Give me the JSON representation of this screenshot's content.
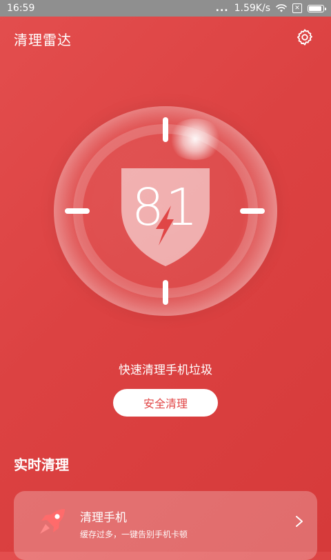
{
  "status_bar": {
    "time": "16:59",
    "dots": "...",
    "speed": "1.59K/s",
    "icons": [
      "wifi-icon",
      "sim-disabled-icon",
      "battery-icon"
    ]
  },
  "header": {
    "title": "清理雷达",
    "icons": [
      "gear-icon"
    ]
  },
  "radar": {
    "score": "81",
    "icons": [
      "shield-icon",
      "lightning-icon"
    ]
  },
  "quick": {
    "subtitle": "快速清理手机垃圾",
    "button_label": "安全清理"
  },
  "realtime": {
    "section_title": "实时清理",
    "card": {
      "title": "清理手机",
      "description": "缓存过多，一键告别手机卡顿",
      "icons": [
        "rocket-icon",
        "chevron-right-icon"
      ]
    }
  },
  "colors": {
    "background_start": "#e34e4e",
    "background_end": "#d63a3a",
    "status_bar": "#8f8f8f",
    "button_text": "#e14545",
    "rocket_accent": "#ff6b6b"
  }
}
